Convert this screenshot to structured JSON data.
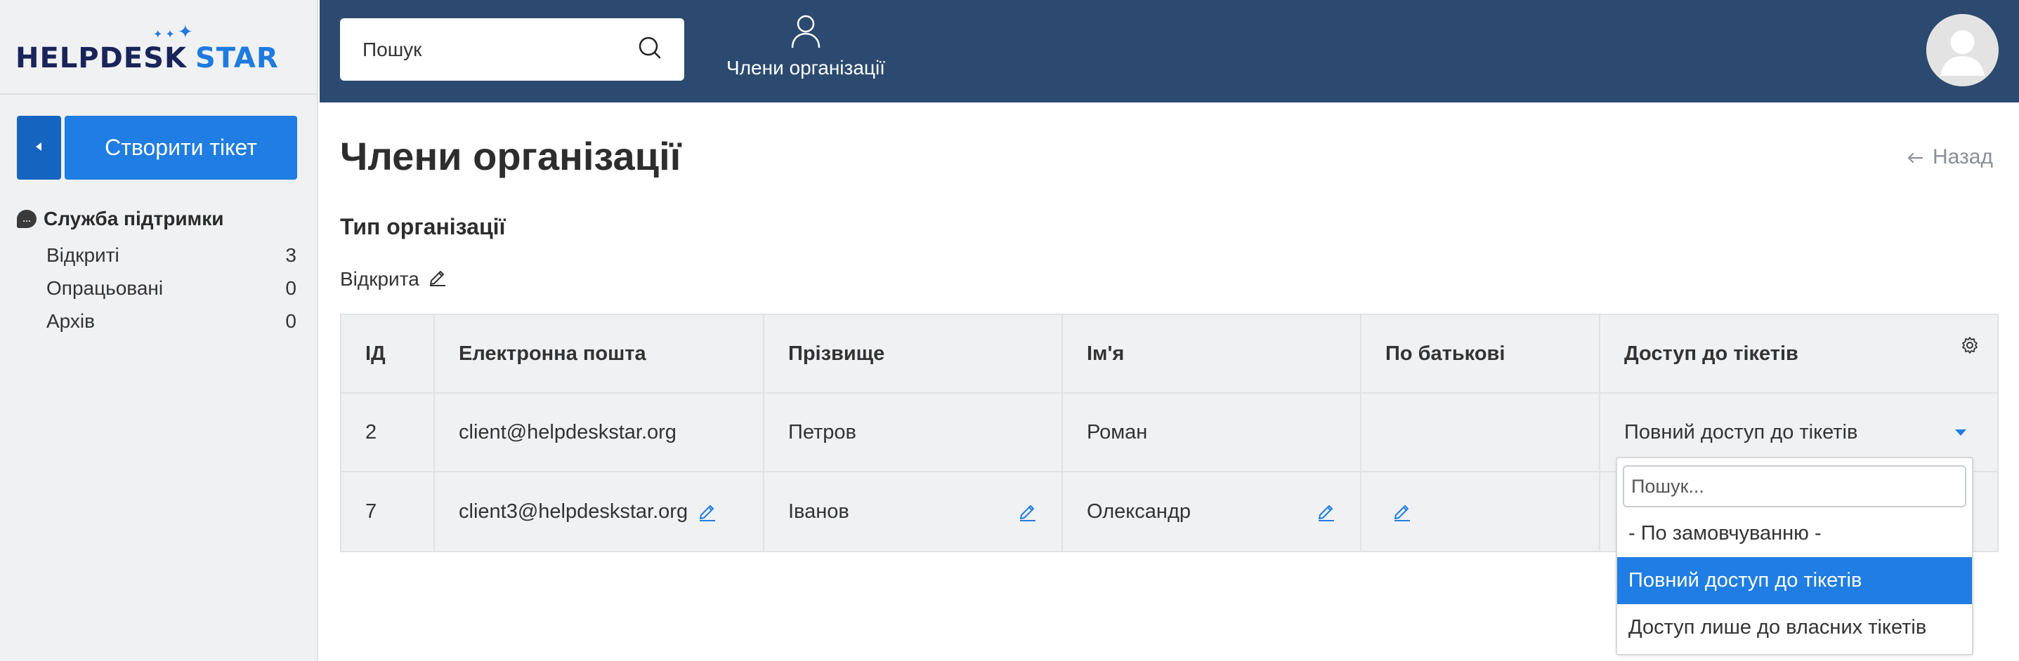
{
  "brand": {
    "name_part1": "HELPDESK",
    "name_part2": "STAR",
    "accent": "#1e7be0",
    "dark": "#18245a"
  },
  "sidebar": {
    "create_ticket_label": "Створити тікет",
    "support_title": "Служба підтримки",
    "items": [
      {
        "label": "Відкриті",
        "count": "3"
      },
      {
        "label": "Опрацьовані",
        "count": "0"
      },
      {
        "label": "Архів",
        "count": "0"
      }
    ]
  },
  "header": {
    "search_placeholder": "Пошук",
    "members_label": "Члени організації",
    "bar_color": "#2c4a70"
  },
  "main": {
    "title": "Члени організації",
    "back_label": "Назад",
    "org_type_title": "Тип організації",
    "org_type_value": "Відкрита"
  },
  "table": {
    "headers": [
      "ІД",
      "Електронна пошта",
      "Прізвище",
      "Ім'я",
      "По батькові",
      "Доступ до тікетів"
    ],
    "rows": [
      {
        "id": "2",
        "email": "client@helpdeskstar.org",
        "last_name": "Петров",
        "first_name": "Роман",
        "middle_name": "",
        "access": "Повний доступ до тікетів"
      },
      {
        "id": "7",
        "email": "client3@helpdeskstar.org",
        "last_name": "Іванов",
        "first_name": "Олександр",
        "middle_name": "",
        "access": ""
      }
    ]
  },
  "dropdown": {
    "search_placeholder": "Пошук...",
    "options": [
      "- По замовчуванню -",
      "Повний доступ до тікетів",
      "Доступ лише до власних тікетів"
    ],
    "selected": "Повний доступ до тікетів"
  }
}
